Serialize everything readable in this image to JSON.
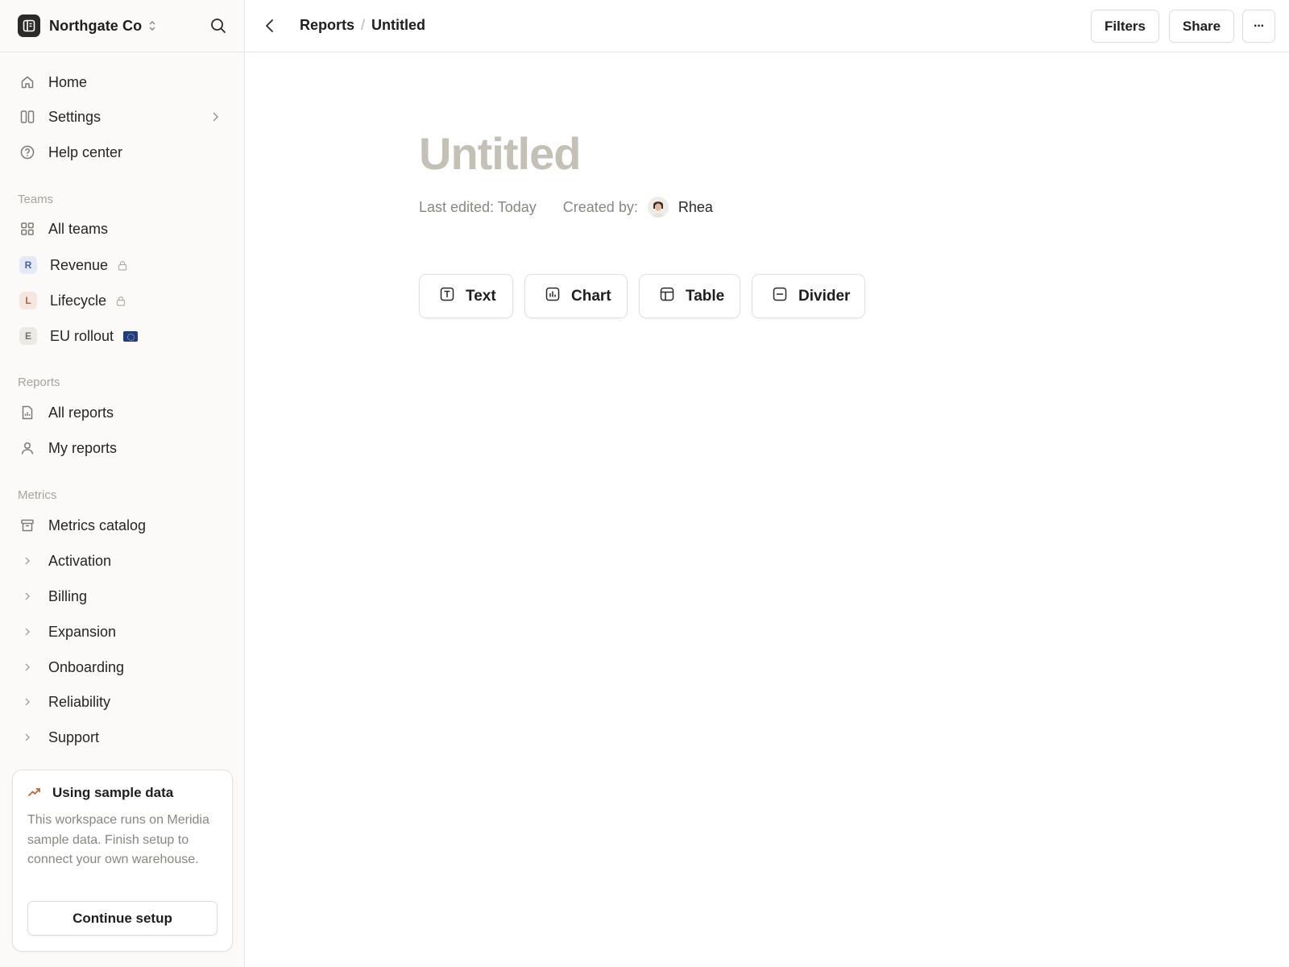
{
  "workspace": {
    "name": "Northgate Co"
  },
  "sidebar": {
    "top_items": [
      {
        "label": "Home",
        "icon": "home-icon"
      },
      {
        "label": "Settings",
        "icon": "columns-icon"
      },
      {
        "label": "Help center",
        "icon": "help-circle-icon"
      }
    ],
    "teams_title": "Teams",
    "teams": [
      {
        "label": "All teams",
        "icon": "grid-icon"
      },
      {
        "label": "Revenue",
        "badge": "R",
        "badge_bg": "#e3e9f7",
        "badge_fg": "#4a5f9a",
        "locked": true
      },
      {
        "label": "Lifecycle",
        "badge": "L",
        "badge_bg": "#f7e6de",
        "badge_fg": "#b0653f",
        "locked": true
      },
      {
        "label": "EU rollout",
        "badge": "E",
        "badge_bg": "#eceae4",
        "badge_fg": "#76726a",
        "flag": "eu-flag-icon"
      }
    ],
    "reports_title": "Reports",
    "reports": [
      {
        "label": "All reports",
        "icon": "report-file-icon"
      },
      {
        "label": "My reports",
        "icon": "user-icon"
      }
    ],
    "metrics_title": "Metrics",
    "metrics": [
      {
        "label": "Metrics catalog",
        "icon": "archive-icon"
      },
      {
        "label": "Activation"
      },
      {
        "label": "Billing"
      },
      {
        "label": "Expansion"
      },
      {
        "label": "Onboarding"
      },
      {
        "label": "Reliability"
      },
      {
        "label": "Support"
      }
    ]
  },
  "promo": {
    "title": "Using sample data",
    "body": "This workspace runs on Meridia sample data. Finish setup to connect your own warehouse.",
    "button": "Continue setup",
    "accent": "#b86a3c"
  },
  "topbar": {
    "breadcrumb_parent": "Reports",
    "breadcrumb_current": "Untitled",
    "filters": "Filters",
    "share": "Share",
    "more": "···"
  },
  "doc": {
    "title": "Untitled",
    "last_edited_label": "Last edited: Today",
    "created_by_label": "Created by:",
    "creator": "Rhea"
  },
  "blocks": [
    {
      "label": "Text",
      "icon": "text-block-icon"
    },
    {
      "label": "Chart",
      "icon": "chart-block-icon"
    },
    {
      "label": "Table",
      "icon": "table-block-icon"
    },
    {
      "label": "Divider",
      "icon": "divider-block-icon"
    }
  ]
}
